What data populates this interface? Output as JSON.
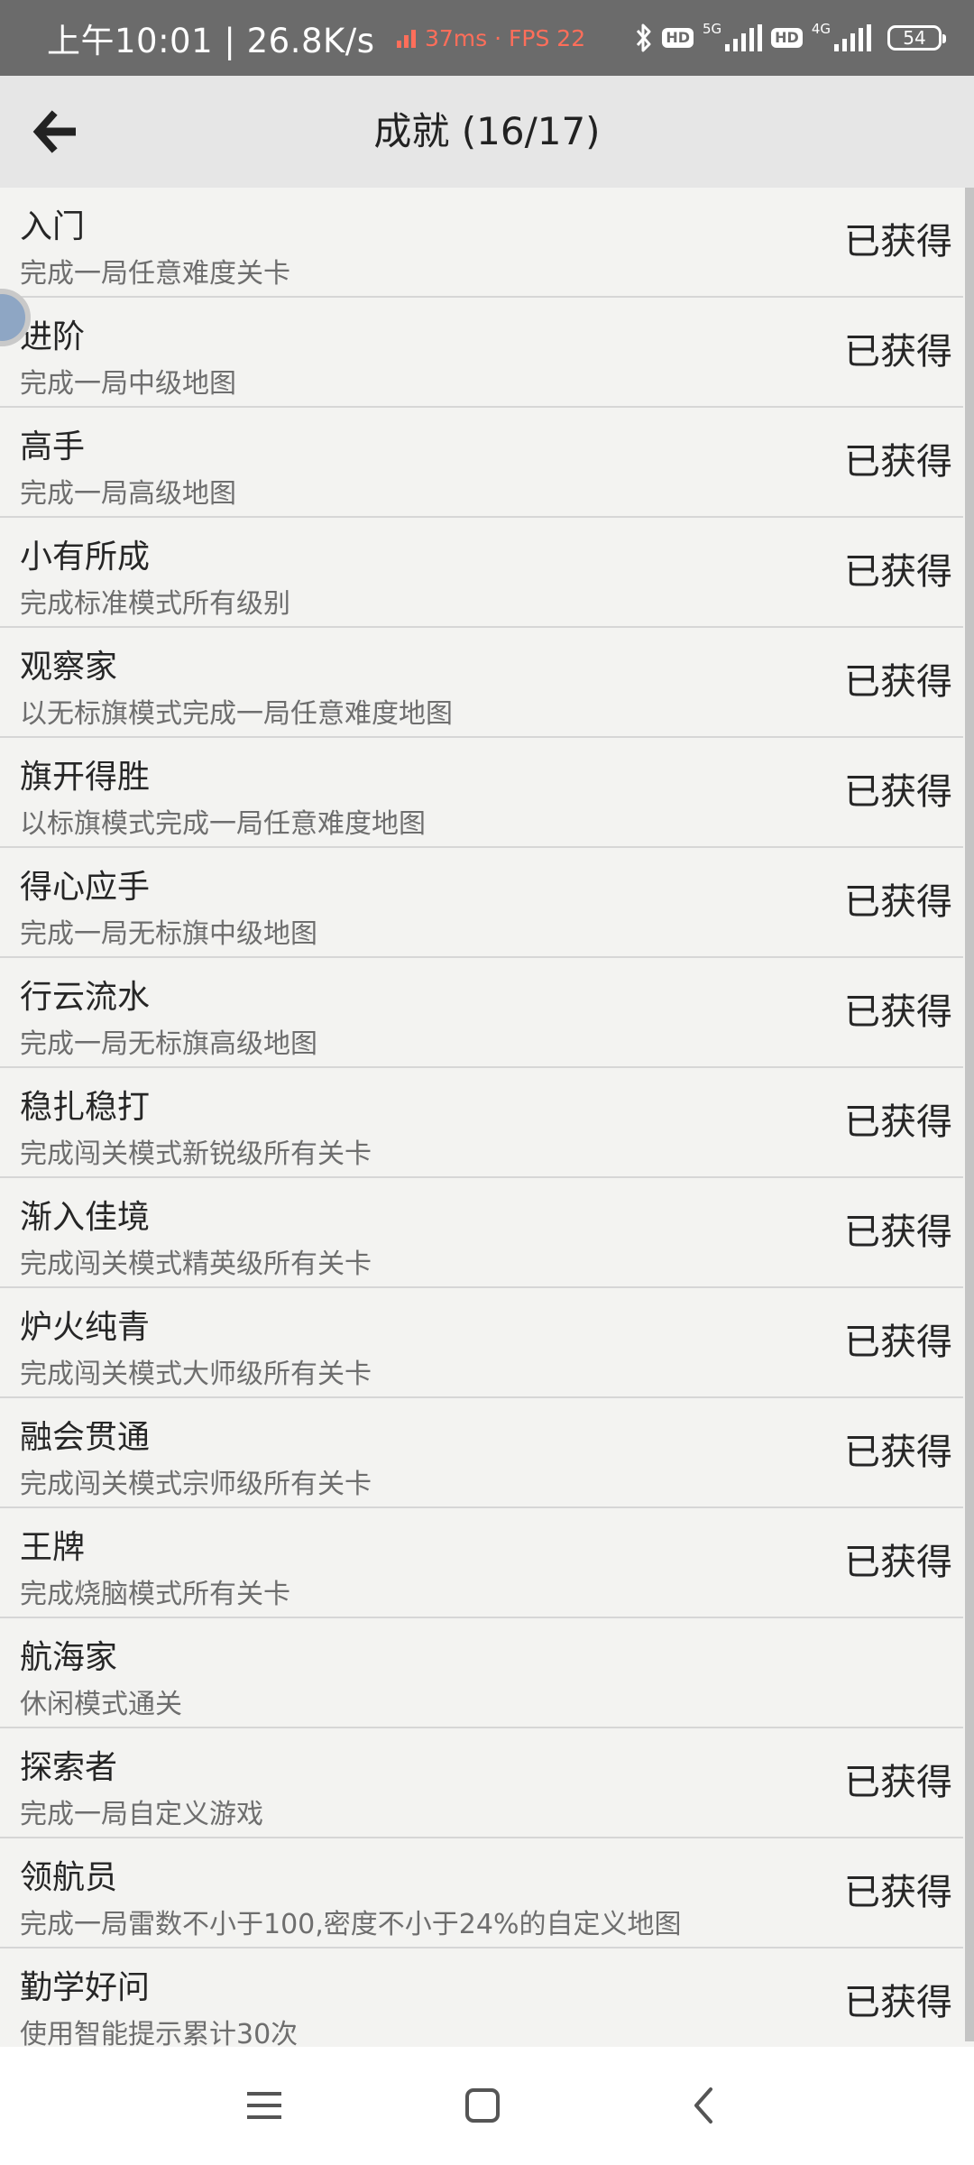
{
  "status_bar": {
    "time_speed": "上午10:01 | 26.8K/s",
    "perf": "37ms · FPS 22",
    "net_5g": "5G",
    "net_4g": "4G",
    "hd": "HD",
    "battery": "54"
  },
  "header": {
    "title": "成就 (16/17)",
    "back_icon": "back-arrow-icon"
  },
  "achievements": [
    {
      "title": "入门",
      "desc": "完成一局任意难度关卡",
      "status": "已获得"
    },
    {
      "title": "进阶",
      "desc": "完成一局中级地图",
      "status": "已获得"
    },
    {
      "title": "高手",
      "desc": "完成一局高级地图",
      "status": "已获得"
    },
    {
      "title": "小有所成",
      "desc": "完成标准模式所有级别",
      "status": "已获得"
    },
    {
      "title": "观察家",
      "desc": "以无标旗模式完成一局任意难度地图",
      "status": "已获得"
    },
    {
      "title": "旗开得胜",
      "desc": "以标旗模式完成一局任意难度地图",
      "status": "已获得"
    },
    {
      "title": "得心应手",
      "desc": "完成一局无标旗中级地图",
      "status": "已获得"
    },
    {
      "title": "行云流水",
      "desc": "完成一局无标旗高级地图",
      "status": "已获得"
    },
    {
      "title": "稳扎稳打",
      "desc": "完成闯关模式新锐级所有关卡",
      "status": "已获得"
    },
    {
      "title": "渐入佳境",
      "desc": "完成闯关模式精英级所有关卡",
      "status": "已获得"
    },
    {
      "title": "炉火纯青",
      "desc": "完成闯关模式大师级所有关卡",
      "status": "已获得"
    },
    {
      "title": "融会贯通",
      "desc": "完成闯关模式宗师级所有关卡",
      "status": "已获得"
    },
    {
      "title": "王牌",
      "desc": "完成烧脑模式所有关卡",
      "status": "已获得"
    },
    {
      "title": "航海家",
      "desc": "休闲模式通关",
      "status": ""
    },
    {
      "title": "探索者",
      "desc": "完成一局自定义游戏",
      "status": "已获得"
    },
    {
      "title": "领航员",
      "desc": "完成一局雷数不小于100,密度不小于24%的自定义地图",
      "status": "已获得"
    },
    {
      "title": "勤学好问",
      "desc": "使用智能提示累计30次",
      "status": "已获得"
    }
  ],
  "nav": {
    "menu_icon": "menu-icon",
    "home_icon": "home-square-icon",
    "back_icon": "back-chevron-icon"
  }
}
